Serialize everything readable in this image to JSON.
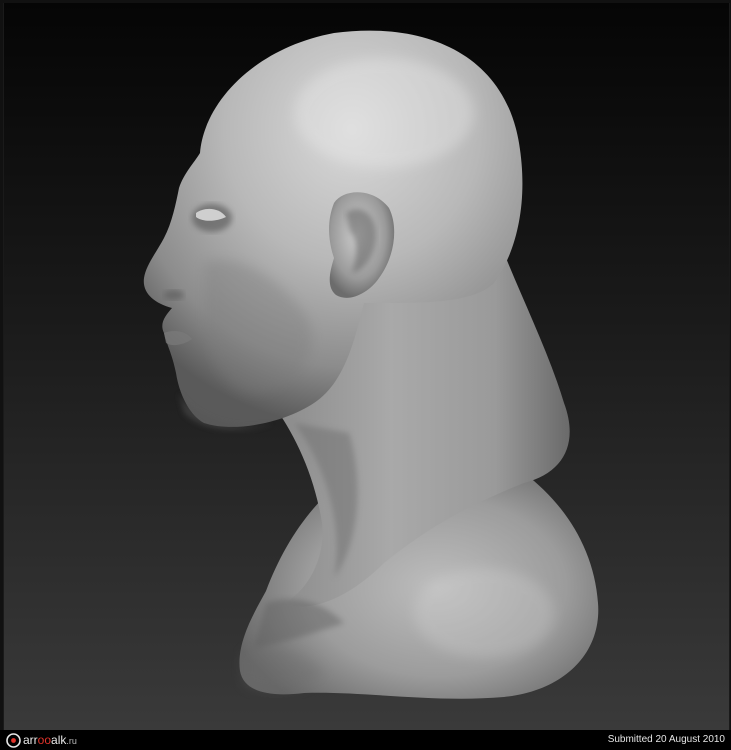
{
  "image": {
    "subject": "head-and-shoulders-sculpt"
  },
  "footer": {
    "logo_prefix": "arr",
    "logo_accent": "oo",
    "logo_middle": "alk",
    "logo_suffix": ".ru",
    "submitted_text": "Submitted 20 August 2010"
  },
  "colors": {
    "logo_accent": "#e2332a",
    "background_top": "#050505",
    "background_bottom": "#3a3a3a"
  }
}
